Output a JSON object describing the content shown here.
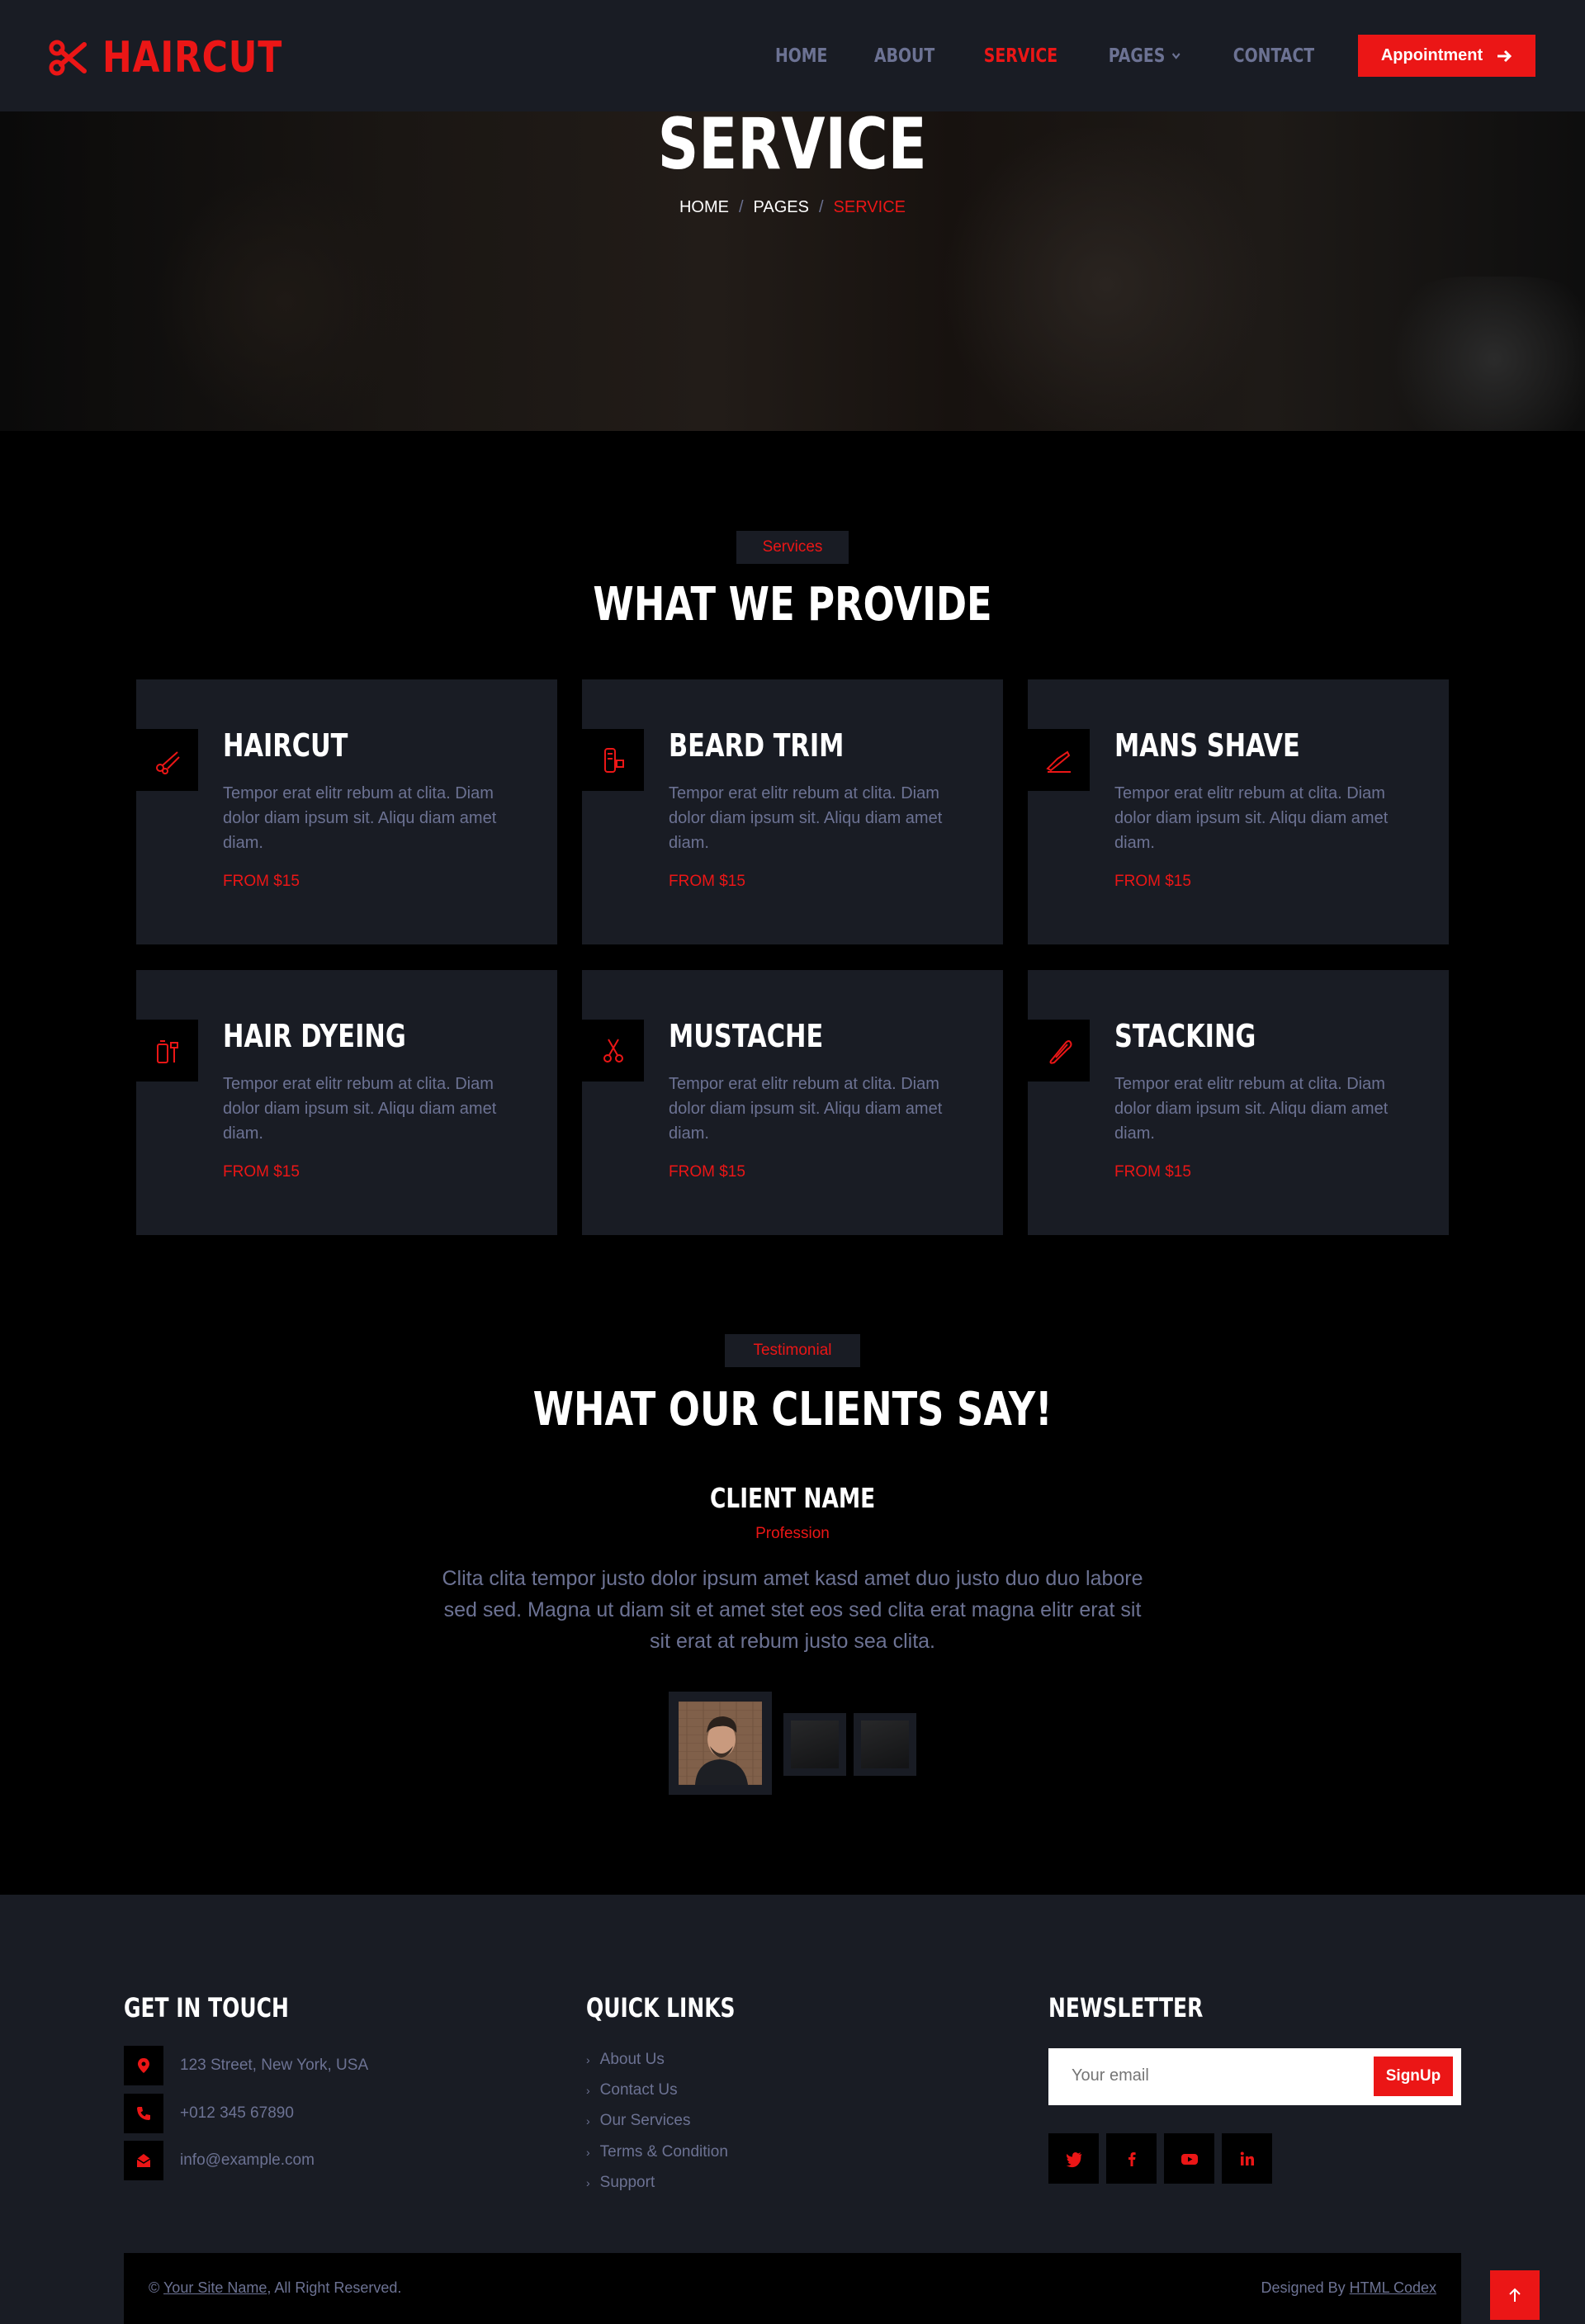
{
  "brand": {
    "name": "HAIRCUT",
    "icon": "scissors-icon"
  },
  "nav": {
    "items": [
      {
        "label": "HOME"
      },
      {
        "label": "ABOUT"
      },
      {
        "label": "SERVICE"
      },
      {
        "label": "PAGES"
      },
      {
        "label": "CONTACT"
      }
    ],
    "active": "SERVICE",
    "cta": "Appointment"
  },
  "hero": {
    "title": "SERVICE",
    "breadcrumb": [
      "HOME",
      "PAGES",
      "SERVICE"
    ]
  },
  "services": {
    "tag": "Services",
    "title": "WHAT WE PROVIDE",
    "items": [
      {
        "title": "HAIRCUT",
        "text": "Tempor erat elitr rebum at clita. Diam dolor diam ipsum sit. Aliqu diam amet diam.",
        "price": "FROM $15",
        "icon": "haircut-icon"
      },
      {
        "title": "BEARD TRIM",
        "text": "Tempor erat elitr rebum at clita. Diam dolor diam ipsum sit. Aliqu diam amet diam.",
        "price": "FROM $15",
        "icon": "trimmer-icon"
      },
      {
        "title": "MANS SHAVE",
        "text": "Tempor erat elitr rebum at clita. Diam dolor diam ipsum sit. Aliqu diam amet diam.",
        "price": "FROM $15",
        "icon": "razor-icon"
      },
      {
        "title": "HAIR DYEING",
        "text": "Tempor erat elitr rebum at clita. Diam dolor diam ipsum sit. Aliqu diam amet diam.",
        "price": "FROM $15",
        "icon": "hair-dye-icon"
      },
      {
        "title": "MUSTACHE",
        "text": "Tempor erat elitr rebum at clita. Diam dolor diam ipsum sit. Aliqu diam amet diam.",
        "price": "FROM $15",
        "icon": "scissors-icon"
      },
      {
        "title": "STACKING",
        "text": "Tempor erat elitr rebum at clita. Diam dolor diam ipsum sit. Aliqu diam amet diam.",
        "price": "FROM $15",
        "icon": "hair-clip-icon"
      }
    ]
  },
  "testimonial": {
    "tag": "Testimonial",
    "title": "WHAT OUR CLIENTS SAY!",
    "name": "CLIENT NAME",
    "profession": "Profession",
    "quote": "Clita clita tempor justo dolor ipsum amet kasd amet duo justo duo duo labore sed sed. Magna ut diam sit et amet stet eos sed clita erat magna elitr erat sit sit erat at rebum justo sea clita."
  },
  "footer": {
    "contact": {
      "heading": "GET IN TOUCH",
      "address": "123 Street, New York, USA",
      "phone": "+012 345 67890",
      "email": "info@example.com"
    },
    "links": {
      "heading": "QUICK LINKS",
      "items": [
        "About Us",
        "Contact Us",
        "Our Services",
        "Terms & Condition",
        "Support"
      ]
    },
    "newsletter": {
      "heading": "NEWSLETTER",
      "placeholder": "Your email",
      "button": "SignUp"
    },
    "social": [
      "twitter-icon",
      "facebook-icon",
      "youtube-icon",
      "linkedin-icon"
    ],
    "copyright": {
      "prefix": "©",
      "site": "Your Site Name",
      "suffix": ", All Right Reserved.",
      "designed_by": "Designed By",
      "designer": "HTML Codex"
    }
  },
  "colors": {
    "accent": "#eb1616",
    "panel": "#191c24",
    "muted": "#6c7293",
    "bg": "#000000"
  }
}
